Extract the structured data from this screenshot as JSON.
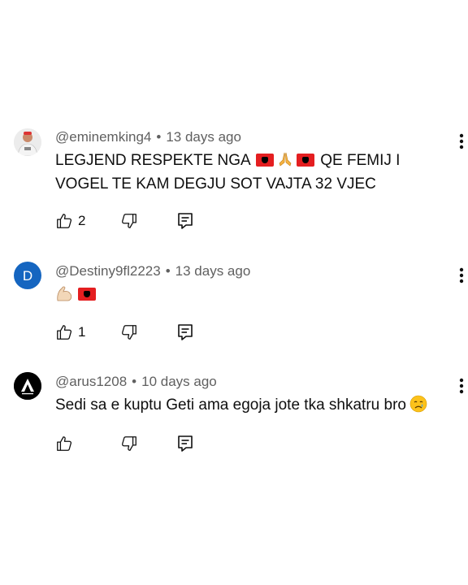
{
  "comments": [
    {
      "author": "@eminemking4",
      "time": "13 days ago",
      "text_parts": [
        "LEGJEND RESPEKTE NGA",
        "QE FEMIJ I VOGEL TE KAM DEGJU SOT VAJTA 32 VJEC"
      ],
      "emojis": [
        "albania-flag",
        "folded-hands",
        "albania-flag"
      ],
      "likes": "2",
      "avatar": "photo"
    },
    {
      "author": "@Destiny9fl2223",
      "time": "13 days ago",
      "emojis": [
        "flexed-biceps",
        "albania-flag"
      ],
      "likes": "1",
      "avatar_letter": "D",
      "avatar_color": "#1565c0"
    },
    {
      "author": "@arus1208",
      "time": "10 days ago",
      "text": "Sedi sa e kuptu Geti ama egoja jote tka shkatru bro",
      "emojis": [
        "crying-face"
      ],
      "likes": "",
      "avatar": "dark-logo"
    }
  ],
  "separator": "•",
  "icons": {
    "like": "thumbs-up-icon",
    "dislike": "thumbs-down-icon",
    "reply": "reply-icon",
    "more": "more-vert-icon"
  },
  "colors": {
    "meta_text": "#606060",
    "body_text": "#0f0f0f",
    "flag_red": "#e41e20"
  }
}
